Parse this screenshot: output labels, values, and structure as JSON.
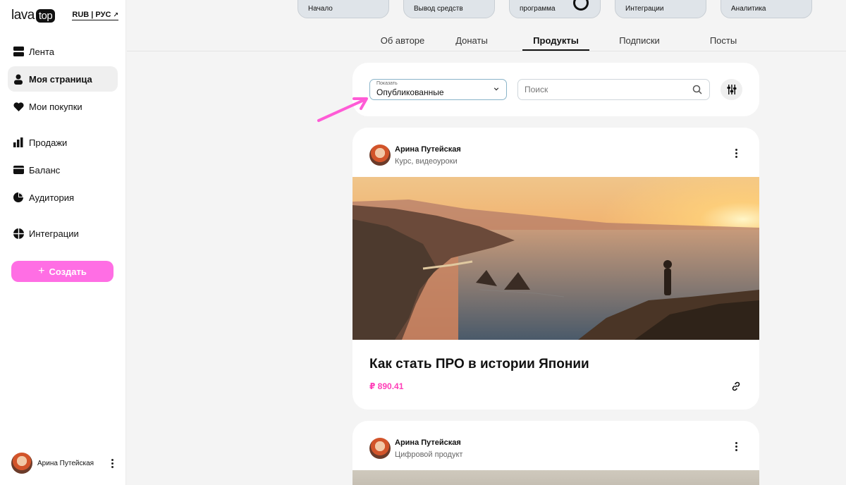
{
  "sidebar": {
    "logo_left": "lava",
    "logo_right": "top",
    "currency": "RUB | РУС",
    "items": [
      {
        "label": "Лента",
        "icon": "feed-icon"
      },
      {
        "label": "Моя страница",
        "icon": "user-icon"
      },
      {
        "label": "Мои покупки",
        "icon": "heart-icon"
      },
      {
        "label": "Продажи",
        "icon": "bar-chart-icon"
      },
      {
        "label": "Баланс",
        "icon": "wallet-icon"
      },
      {
        "label": "Аудитория",
        "icon": "pie-chart-icon"
      },
      {
        "label": "Интеграции",
        "icon": "integrations-icon"
      }
    ],
    "create_label": "Создать",
    "user_name": "Арина Путейская"
  },
  "top_cards": [
    "Начало",
    "Вывод средств",
    "программа",
    "Интеграции",
    "Аналитика"
  ],
  "tabs": [
    "Об авторе",
    "Донаты",
    "Продукты",
    "Подписки",
    "Посты"
  ],
  "active_tab": "Продукты",
  "filter": {
    "select_label": "Показать",
    "select_value": "Опубликованные",
    "search_placeholder": "Поиск"
  },
  "products": [
    {
      "author": "Арина Путейская",
      "type": "Курс, видеоуроки",
      "title": "Как стать ПРО в истории Японии",
      "price": "₽ 890.41"
    },
    {
      "author": "Арина Путейская",
      "type": "Цифровой продукт"
    }
  ],
  "colors": {
    "accent_pink": "#ff6ee4",
    "price_pink": "#ff3fb8",
    "arrow_pink": "#ff5bd6"
  }
}
